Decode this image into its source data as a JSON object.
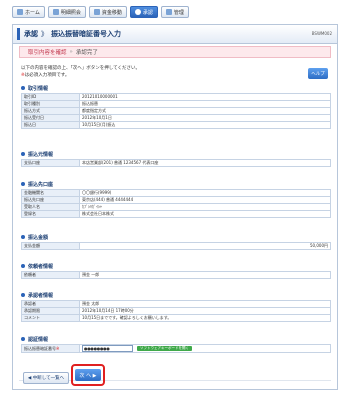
{
  "tabs": [
    {
      "label": "ホーム",
      "icon": "home-icon",
      "active": false
    },
    {
      "label": "明細照会",
      "icon": "statement-icon",
      "active": false
    },
    {
      "label": "資金移動",
      "icon": "transfer-icon",
      "active": false
    },
    {
      "label": "承認",
      "icon": "check-icon",
      "active": true
    },
    {
      "label": "管理",
      "icon": "admin-icon",
      "active": false
    }
  ],
  "header": {
    "section": "承認",
    "separator": "》",
    "title": "振込振替暗証番号入力",
    "code": "BSWM002"
  },
  "steps": {
    "current": "取引内容を確認",
    "arrow": "»",
    "next": "承認完了"
  },
  "intro": {
    "line1": "以下の内容を確認の上、「次へ」ボタンを押してください。",
    "required_mark": "※",
    "line2": "は必須入力項目です。"
  },
  "help_label": "ヘルプ",
  "sections": {
    "transaction": {
      "title": "取引情報",
      "rows": [
        {
          "k": "取引ID",
          "v": "20121010000001"
        },
        {
          "k": "取引種別",
          "v": "振込振替"
        },
        {
          "k": "振込方式",
          "v": "都度指定方式"
        },
        {
          "k": "振込受付日",
          "v": "2012年10月1日"
        },
        {
          "k": "振込日",
          "v": "10月15日(月)振込"
        }
      ]
    },
    "source": {
      "title": "振込元情報",
      "rows": [
        {
          "k": "支払口座",
          "v": "本店営業部(201) 普通 1234567 代表口座"
        }
      ]
    },
    "destination": {
      "title": "振込先口座",
      "rows": [
        {
          "k": "金融機関名",
          "v": "〇〇銀行(9999)"
        },
        {
          "k": "振込先口座",
          "v": "東京店(444) 普通 4444444"
        },
        {
          "k": "受取人名",
          "v": "ｶﾌﾞｼｷｶﾞｲｼｬ"
        },
        {
          "k": "登録名",
          "v": "株式会社日本株式"
        }
      ]
    },
    "amount": {
      "title": "振込金額",
      "rows": [
        {
          "k": "支払金額",
          "v": "50,000円"
        }
      ]
    },
    "requester": {
      "title": "依頼者情報",
      "rows": [
        {
          "k": "依頼者",
          "v": "預金 一郎"
        }
      ]
    },
    "approver": {
      "title": "承認者情報",
      "rows": [
        {
          "k": "承認者",
          "v": "預金 太郎"
        },
        {
          "k": "承認期限",
          "v": "2012年10月14日 17時00分"
        },
        {
          "k": "コメント",
          "v": "10月15日までです。確認よろしくお願いします。"
        }
      ]
    },
    "auth": {
      "title": "認証情報",
      "label": "振込振替暗証番号",
      "required_mark": "※",
      "value": "●●●●●●●●",
      "keyboard_label": "ソフトウェアキーボードを開く"
    }
  },
  "buttons": {
    "back": "◀ 中断して一覧へ",
    "next": "次 へ ▶"
  }
}
